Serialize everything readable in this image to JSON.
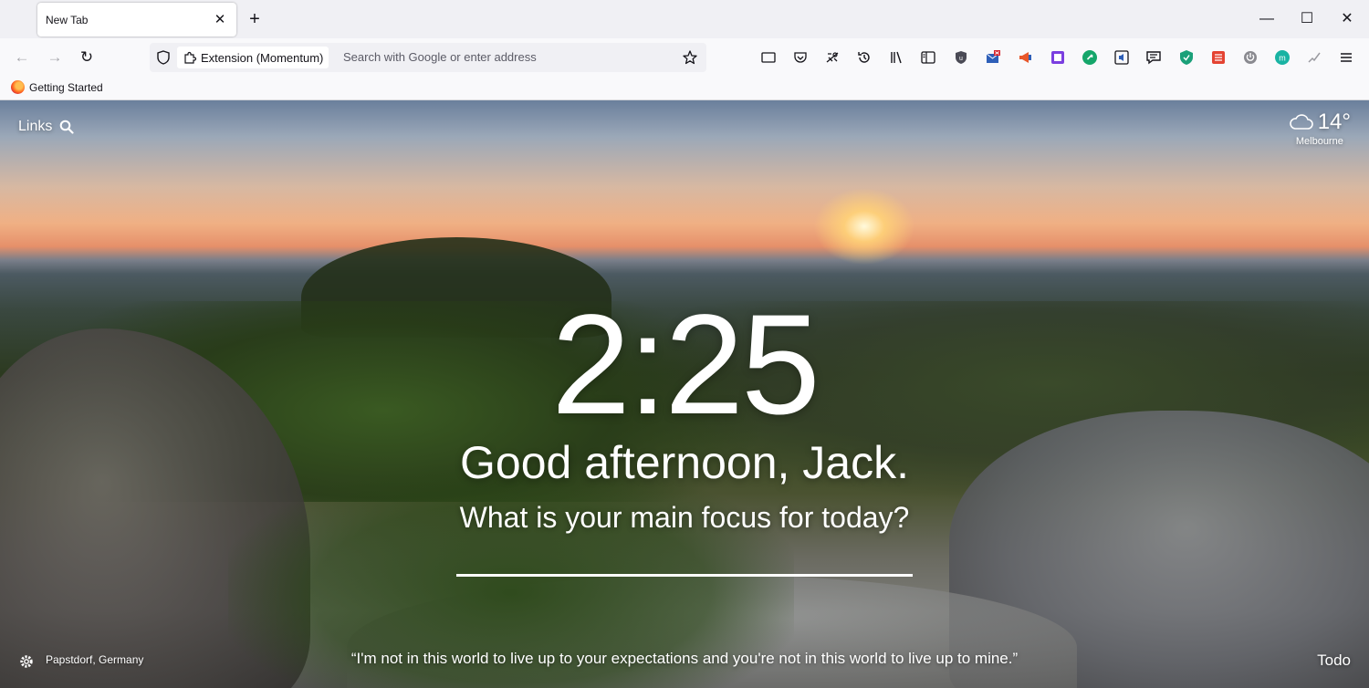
{
  "tab": {
    "title": "New Tab",
    "close_glyph": "✕"
  },
  "newtab_glyph": "+",
  "window_controls": {
    "minimize": "—",
    "maximize": "☐",
    "close": "✕"
  },
  "nav": {
    "back_glyph": "←",
    "forward_glyph": "→",
    "reload_glyph": "↻"
  },
  "urlbar": {
    "extension_label": "Extension (Momentum)",
    "placeholder": "Search with Google or enter address"
  },
  "toolbar_icons": [
    "screenshot-icon",
    "pocket-icon",
    "extensions-manage-icon",
    "history-icon",
    "library-icon",
    "sidebar-icon",
    "ublock-icon",
    "mail-icon",
    "announce-icon",
    "square-ext-icon",
    "grammarly-icon",
    "audio-ext-icon",
    "chat-ext-icon",
    "shield-ext-icon",
    "todoist-ext-icon",
    "power-ext-icon",
    "momentum-ext-icon",
    "check-ext-icon",
    "menu-icon"
  ],
  "bookmarks": {
    "getting_started": "Getting Started"
  },
  "momentum": {
    "links_label": "Links",
    "weather": {
      "temp": "14°",
      "location": "Melbourne"
    },
    "clock": "2:25",
    "greeting": "Good afternoon, Jack.",
    "focus_question": "What is your main focus for today?",
    "focus_value": "",
    "photo_location": "Papstdorf, Germany",
    "quote": "“I'm not in this world to live up to your expectations and you're not in this world to live up to mine.”",
    "todo_label": "Todo"
  }
}
